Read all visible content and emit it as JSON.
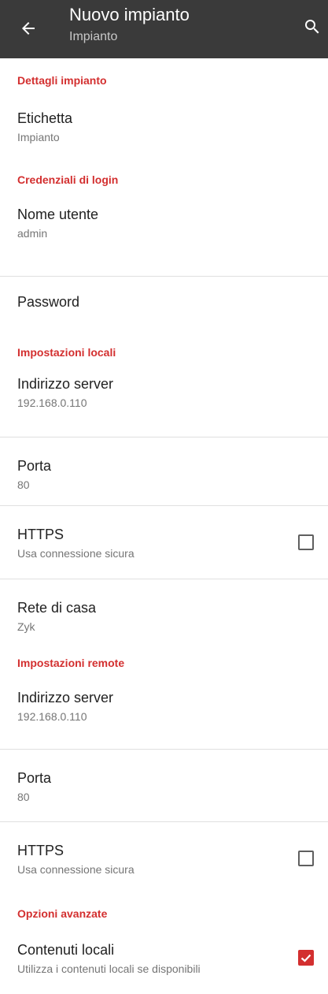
{
  "appbar": {
    "title": "Nuovo impianto",
    "subtitle": "Impianto",
    "back_icon": "arrow-back-icon",
    "search_icon": "search-icon"
  },
  "sections": {
    "details": "Dettagli impianto",
    "login": "Credenziali di login",
    "local": "Impostazioni locali",
    "remote": "Impostazioni remote",
    "advanced": "Opzioni avanzate"
  },
  "details": {
    "label_title": "Etichetta",
    "label_value": "Impianto"
  },
  "login": {
    "username_title": "Nome utente",
    "username_value": "admin",
    "password_title": "Password"
  },
  "local": {
    "server_title": "Indirizzo server",
    "server_value": "192.168.0.110",
    "port_title": "Porta",
    "port_value": "80",
    "https_title": "HTTPS",
    "https_summary": "Usa connessione sicura",
    "https_checked": false,
    "home_network_title": "Rete di casa",
    "home_network_value": "Zyk"
  },
  "remote": {
    "server_title": "Indirizzo server",
    "server_value": "192.168.0.110",
    "port_title": "Porta",
    "port_value": "80",
    "https_title": "HTTPS",
    "https_summary": "Usa connessione sicura",
    "https_checked": false
  },
  "advanced": {
    "local_content_title": "Contenuti locali",
    "local_content_summary": "Utilizza i contenuti locali se disponibili",
    "local_content_checked": true
  },
  "colors": {
    "appbar": "#3a3a3a",
    "accent": "#d32f2f"
  }
}
